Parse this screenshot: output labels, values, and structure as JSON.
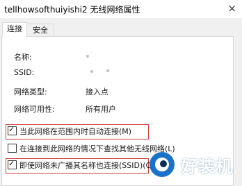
{
  "window": {
    "title": "tellhowsofthuiyishi2 无线网络属性",
    "close_glyph": "×"
  },
  "tabs": [
    {
      "label": "连接"
    },
    {
      "label": "安全"
    }
  ],
  "details": [
    {
      "label": "名称:",
      "value": ""
    },
    {
      "label": "SSID:",
      "value": ""
    },
    {
      "label": "网络类型:",
      "value": "接入点"
    },
    {
      "label": "网络可用性:",
      "value": "所有用户"
    }
  ],
  "options": [
    {
      "label": "当此网络在范围内时自动连接(M)",
      "checked": true
    },
    {
      "label": "在连接到此网络的情况下查找其他无线网络(L)",
      "checked": false
    },
    {
      "label": "即使网络未广播其名称也连接(SSID)(O)",
      "checked": true
    }
  ],
  "watermark": {
    "text": "好装机"
  },
  "colors": {
    "highlight": "#c9403b",
    "watermark_blue": "#1a73c9"
  }
}
